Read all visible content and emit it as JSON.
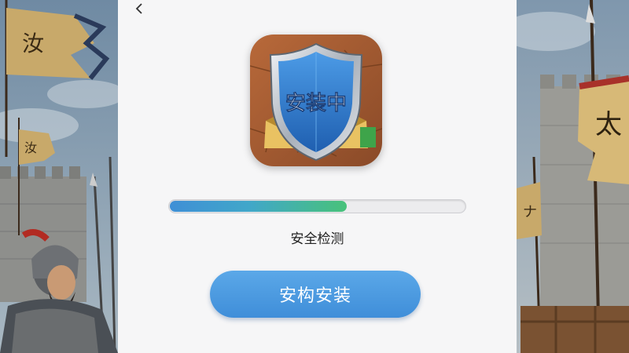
{
  "header": {
    "back_icon": "chevron-left-icon"
  },
  "app_icon": {
    "badge_text": "安装中",
    "icon": "shield-icon"
  },
  "progress": {
    "value": 0.6
  },
  "status": {
    "text": "安全检测"
  },
  "install_button": {
    "label": "安构安装"
  },
  "background": {
    "left_flag_text_1": "汝",
    "left_flag_text_2": "汝",
    "right_flag_text_1": "太",
    "right_flag_text_2": "ナ"
  },
  "colors": {
    "accent": "#4697e0",
    "progress_start": "#3f8fd6",
    "progress_end": "#48c27a",
    "shield": "#2f76c9"
  }
}
